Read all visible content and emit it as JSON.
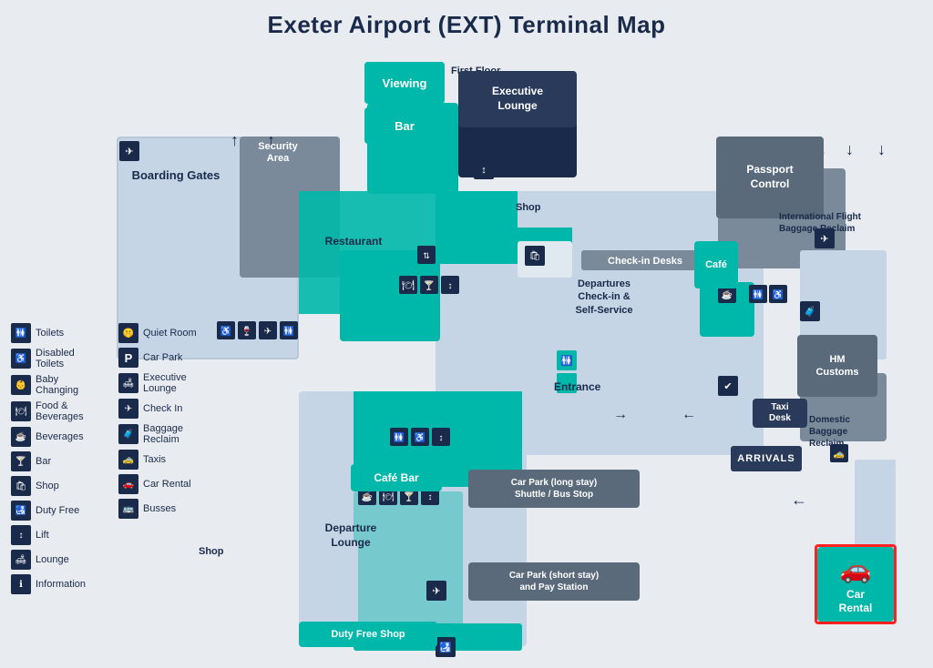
{
  "page": {
    "title": "Exeter Airport (EXT) Terminal Map"
  },
  "map": {
    "areas": [
      {
        "id": "boarding-gates",
        "label": "Boarding Gates"
      },
      {
        "id": "security-area",
        "label": "Security Area"
      },
      {
        "id": "viewing",
        "label": "Viewing"
      },
      {
        "id": "bar",
        "label": "Bar"
      },
      {
        "id": "restaurant",
        "label": "Restaurant"
      },
      {
        "id": "shop",
        "label": "Shop"
      },
      {
        "id": "executive-lounge",
        "label": "Executive Lounge"
      },
      {
        "id": "first-floor",
        "label": "First Floor"
      },
      {
        "id": "checkin-desks",
        "label": "Check-in Desks"
      },
      {
        "id": "passport-control",
        "label": "Passport Control"
      },
      {
        "id": "intl-baggage",
        "label": "International Flight Baggage Reclaim"
      },
      {
        "id": "cafe",
        "label": "Café"
      },
      {
        "id": "departures-checkin",
        "label": "Departures Check-in & Self-Service"
      },
      {
        "id": "entrance",
        "label": "Entrance"
      },
      {
        "id": "hm-customs",
        "label": "HM Customs"
      },
      {
        "id": "taxi-desk",
        "label": "Taxi Desk"
      },
      {
        "id": "arrivals",
        "label": "ARRIVALS"
      },
      {
        "id": "domestic-baggage",
        "label": "Domestic Baggage Reclaim"
      },
      {
        "id": "cafe-bar",
        "label": "Café Bar"
      },
      {
        "id": "departure-lounge",
        "label": "Departure Lounge"
      },
      {
        "id": "shop-lower",
        "label": "Shop"
      },
      {
        "id": "duty-free",
        "label": "Duty Free Shop"
      },
      {
        "id": "car-park-long",
        "label": "Car Park (long stay) Shuttle / Bus Stop"
      },
      {
        "id": "car-park-short",
        "label": "Car Park (short stay) and Pay Station"
      },
      {
        "id": "car-rental",
        "label": "Car Rental"
      }
    ]
  },
  "legend": {
    "col1": [
      {
        "icon": "🚻",
        "label": "Toilets"
      },
      {
        "icon": "♿",
        "label": "Disabled Toilets"
      },
      {
        "icon": "👶",
        "label": "Baby Changing"
      },
      {
        "icon": "🍽",
        "label": "Food & Beverages"
      },
      {
        "icon": "☕",
        "label": "Beverages"
      },
      {
        "icon": "🍸",
        "label": "Bar"
      },
      {
        "icon": "🛍",
        "label": "Shop"
      },
      {
        "icon": "🛃",
        "label": "Duty Free"
      },
      {
        "icon": "🛗",
        "label": "Lift"
      },
      {
        "icon": "🛋",
        "label": "Lounge"
      },
      {
        "icon": "ℹ",
        "label": "Information"
      }
    ],
    "col2": [
      {
        "icon": "🤫",
        "label": "Quiet Room"
      },
      {
        "icon": "P",
        "label": "Car Park"
      },
      {
        "icon": "🛋",
        "label": "Executive Lounge"
      },
      {
        "icon": "✈",
        "label": "Check In"
      },
      {
        "icon": "🧳",
        "label": "Baggage Reclaim"
      },
      {
        "icon": "🚕",
        "label": "Taxis"
      },
      {
        "icon": "🚗",
        "label": "Car Rental"
      },
      {
        "icon": "🚌",
        "label": "Busses"
      }
    ]
  }
}
